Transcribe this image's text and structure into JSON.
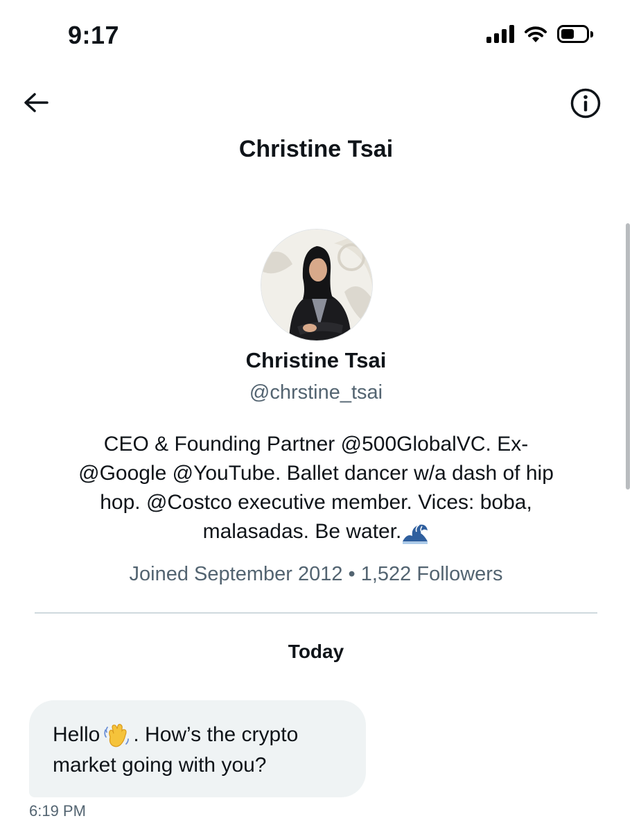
{
  "status_bar": {
    "time": "9:17",
    "icons": [
      "cellular-signal-icon",
      "wifi-icon",
      "battery-icon"
    ]
  },
  "header": {
    "back_icon": "arrow-left-icon",
    "info_icon": "info-circle-icon",
    "title": "Christine Tsai"
  },
  "profile": {
    "name": "Christine Tsai",
    "handle": "@chrstine_tsai",
    "bio_line1": "CEO & Founding Partner @500GlobalVC. Ex-",
    "bio_line2": "@Google @YouTube. Ballet dancer w/a dash of hip",
    "bio_line3": "hop. @Costco executive member. Vices: boba,",
    "bio_line4": "malasadas. Be water.",
    "bio_emoji": "wave-emoji",
    "meta": "Joined September 2012 • 1,522 Followers"
  },
  "conversation": {
    "day_label": "Today",
    "messages": [
      {
        "text_part1": "Hello",
        "emoji": "waving-hand-emoji",
        "text_part2": ". How’s the crypto",
        "text_line2": "market going with you?",
        "time": "6:19 PM"
      }
    ]
  },
  "colors": {
    "text_primary": "#0f1419",
    "text_secondary": "#536471",
    "bubble_bg": "#eff3f4",
    "divider": "#cfd9de"
  }
}
